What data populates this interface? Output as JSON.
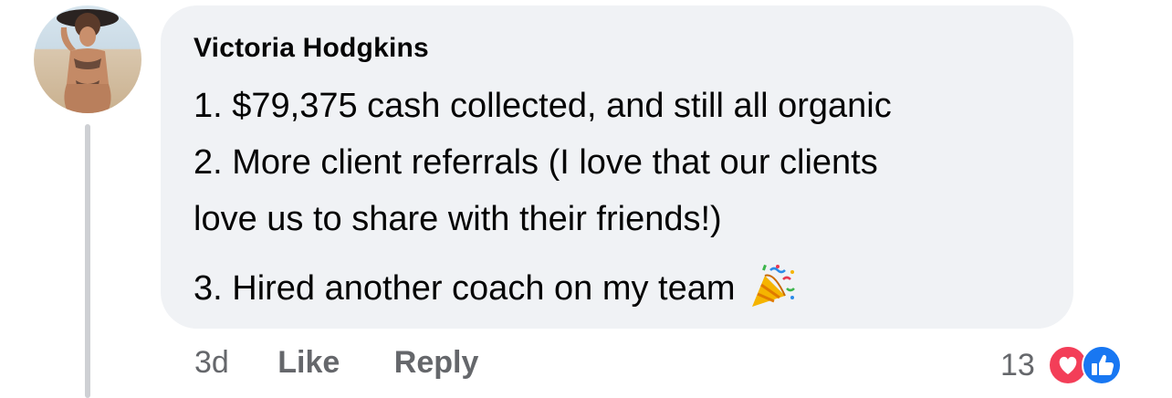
{
  "comment": {
    "author": "Victoria Hodgkins",
    "lines": [
      "1. $79,375 cash collected, and still all organic",
      "2. More client referrals (I love that our clients",
      "love us to share with their friends!)",
      "3. Hired another coach on my team"
    ],
    "emoji": "party-popper-icon"
  },
  "actions": {
    "time": "3d",
    "like_label": "Like",
    "reply_label": "Reply"
  },
  "reactions": {
    "count": "13",
    "types": [
      "love",
      "like"
    ],
    "colors": {
      "love": "#f33e58",
      "like": "#1877f2"
    }
  }
}
